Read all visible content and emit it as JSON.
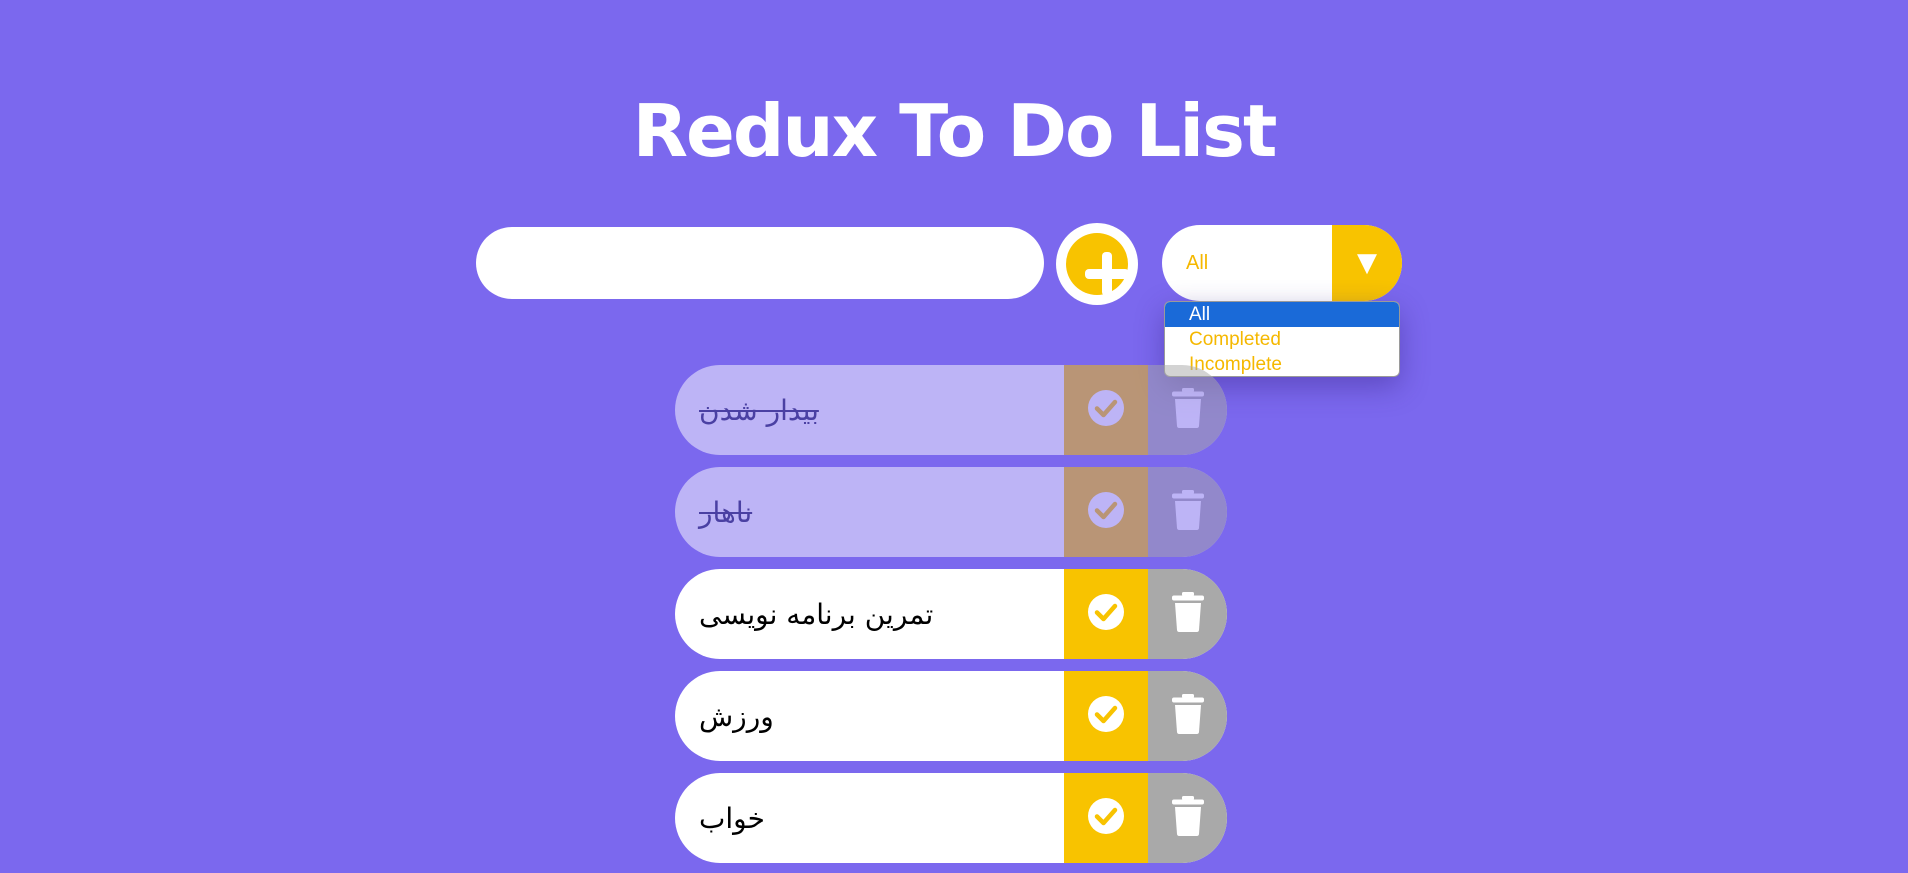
{
  "header": {
    "title": "Redux To Do List"
  },
  "form": {
    "input_value": "",
    "input_placeholder": ""
  },
  "filter": {
    "selected": "All",
    "arrow": "▼",
    "options": [
      "All",
      "Completed",
      "Incomplete"
    ],
    "highlighted_option": "All"
  },
  "todos": [
    {
      "text": "بیدار شدن",
      "completed": true
    },
    {
      "text": "ناهار",
      "completed": true
    },
    {
      "text": "تمرین برنامه نویسی",
      "completed": false
    },
    {
      "text": "ورزش",
      "completed": false
    },
    {
      "text": "خواب",
      "completed": false
    }
  ],
  "icons": {
    "add": "plus-circle-icon",
    "check": "check-circle-icon",
    "delete": "trash-icon"
  },
  "colors": {
    "background": "#7b68ee",
    "accent": "#f8c300",
    "delete": "#a9a9a9",
    "highlight": "#1a6ad8"
  }
}
